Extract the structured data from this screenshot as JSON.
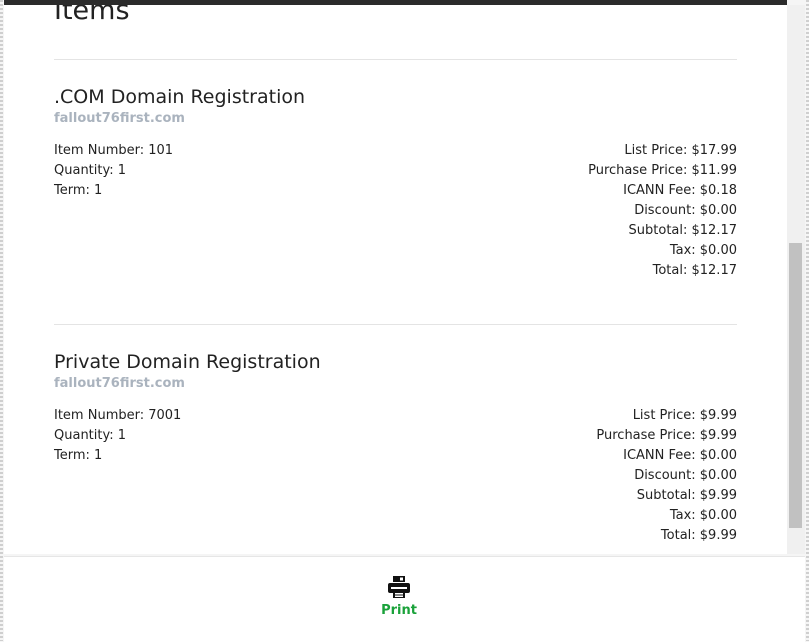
{
  "page": {
    "heading": "Items"
  },
  "items": [
    {
      "title": ".COM Domain Registration",
      "domain": "fallout76first.com",
      "left": [
        "Item Number: 101",
        "Quantity: 1",
        "Term: 1"
      ],
      "right": [
        "List Price: $17.99",
        "Purchase Price: $11.99",
        "ICANN Fee: $0.18",
        "Discount: $0.00",
        "Subtotal: $12.17",
        "Tax: $0.00",
        "Total: $12.17"
      ]
    },
    {
      "title": "Private Domain Registration",
      "domain": "fallout76first.com",
      "left": [
        "Item Number: 7001",
        "Quantity: 1",
        "Term: 1"
      ],
      "right": [
        "List Price: $9.99",
        "Purchase Price: $9.99",
        "ICANN Fee: $0.00",
        "Discount: $0.00",
        "Subtotal: $9.99",
        "Tax: $0.00",
        "Total: $9.99"
      ]
    }
  ],
  "footer": {
    "print_label": "Print",
    "print_icon": "printer-icon",
    "print_color": "#1aa23a"
  }
}
